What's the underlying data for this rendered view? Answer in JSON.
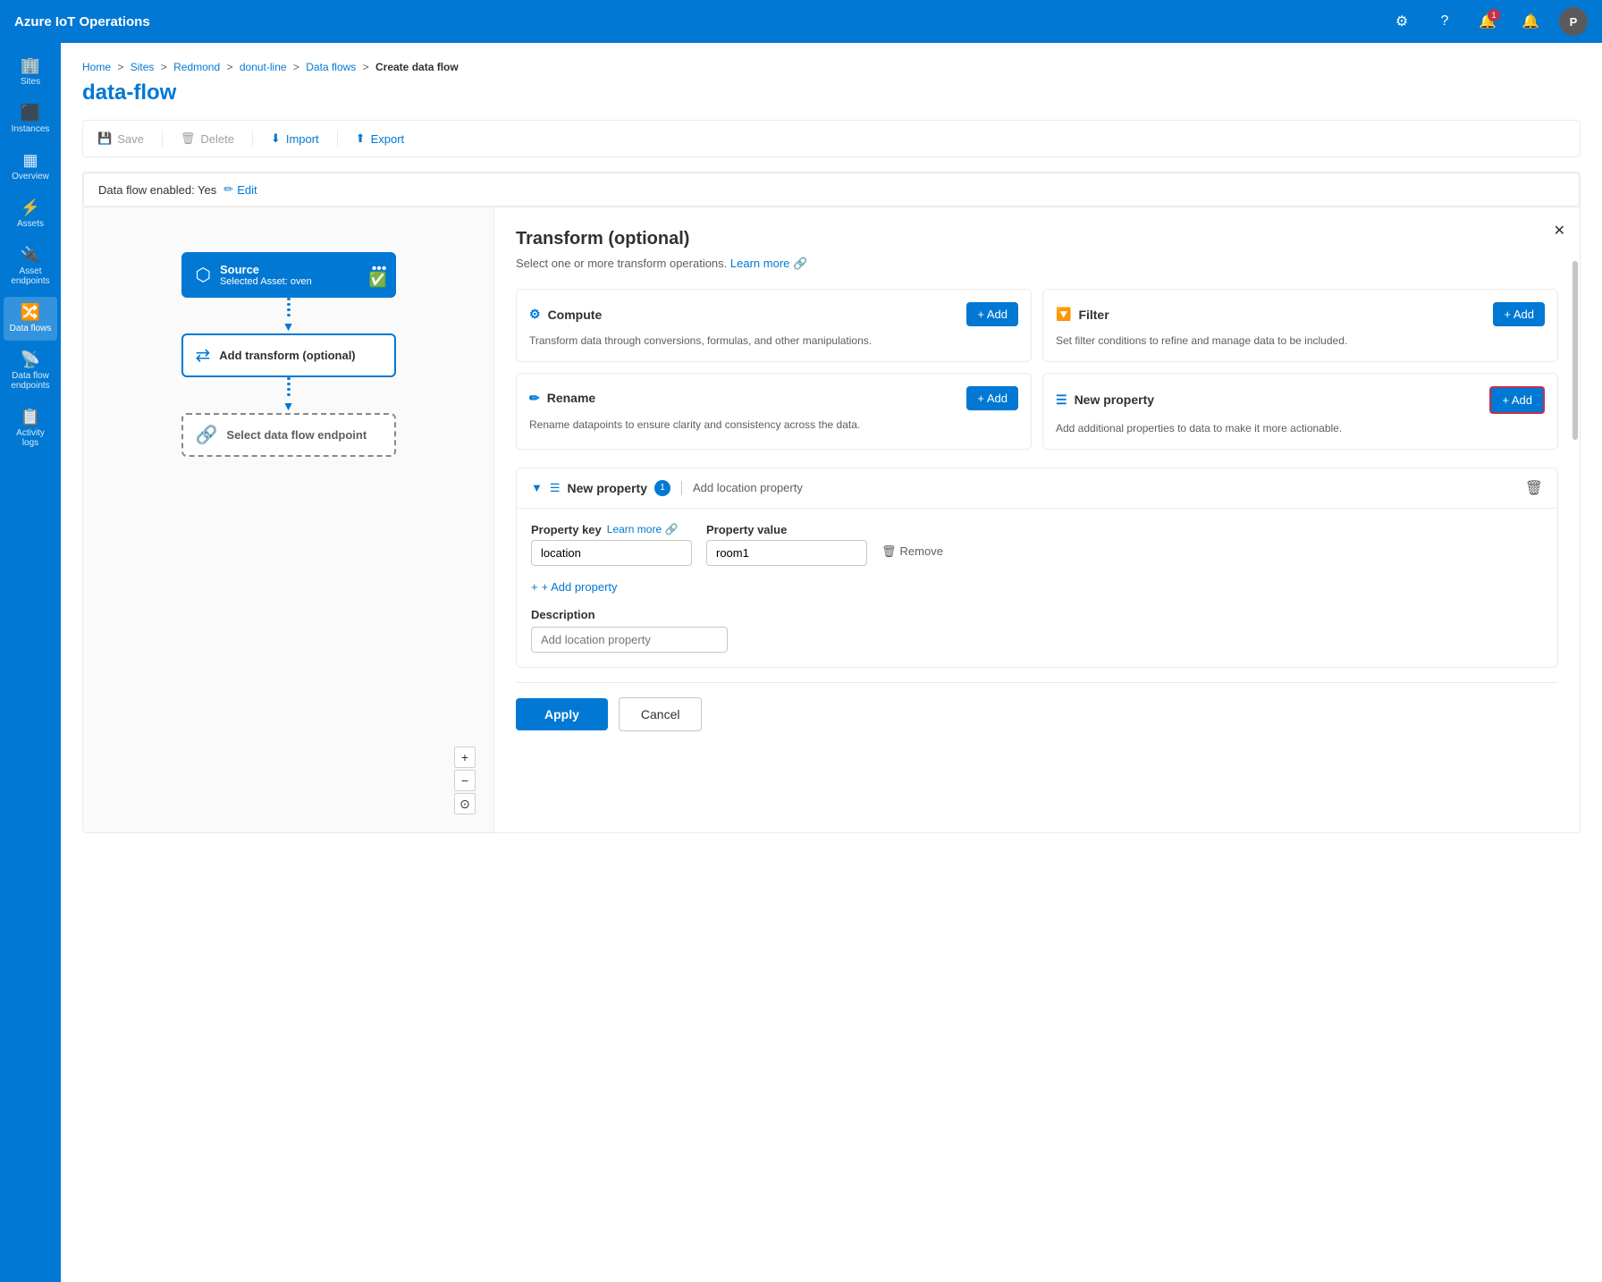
{
  "app": {
    "title": "Azure IoT Operations",
    "avatar_label": "P"
  },
  "sidebar": {
    "items": [
      {
        "id": "sites",
        "label": "Sites",
        "icon": "🏢"
      },
      {
        "id": "instances",
        "label": "Instances",
        "icon": "📦"
      },
      {
        "id": "overview",
        "label": "Overview",
        "icon": "🔲"
      },
      {
        "id": "assets",
        "label": "Assets",
        "icon": "⚡"
      },
      {
        "id": "asset-endpoints",
        "label": "Asset endpoints",
        "icon": "🔌"
      },
      {
        "id": "data-flows",
        "label": "Data flows",
        "icon": "🔀",
        "active": true
      },
      {
        "id": "data-flow-endpoints",
        "label": "Data flow endpoints",
        "icon": "📡"
      },
      {
        "id": "activity-logs",
        "label": "Activity logs",
        "icon": "📋"
      }
    ]
  },
  "breadcrumb": {
    "items": [
      "Home",
      "Sites",
      "Redmond",
      "donut-line",
      "Data flows"
    ],
    "current": "Create data flow"
  },
  "page": {
    "title": "data-flow"
  },
  "toolbar": {
    "save_label": "Save",
    "delete_label": "Delete",
    "import_label": "Import",
    "export_label": "Export"
  },
  "flow_enabled": {
    "label": "Data flow enabled: Yes",
    "edit_label": "Edit"
  },
  "canvas": {
    "source_node": {
      "title": "Source",
      "label": "Selected Asset: oven"
    },
    "transform_node": {
      "title": "Add transform (optional)"
    },
    "endpoint_node": {
      "title": "Select data flow endpoint"
    },
    "zoom_plus": "+",
    "zoom_minus": "−",
    "zoom_reset": "⊙"
  },
  "panel": {
    "title": "Transform (optional)",
    "subtitle": "Select one or more transform operations.",
    "learn_more": "Learn more",
    "ops": [
      {
        "id": "compute",
        "title": "Compute",
        "desc": "Transform data through conversions, formulas, and other manipulations.",
        "add_label": "+ Add"
      },
      {
        "id": "filter",
        "title": "Filter",
        "desc": "Set filter conditions to refine and manage data to be included.",
        "add_label": "+ Add"
      },
      {
        "id": "rename",
        "title": "Rename",
        "desc": "Rename datapoints to ensure clarity and consistency across the data.",
        "add_label": "+ Add"
      },
      {
        "id": "new-property",
        "title": "New property",
        "desc": "Add additional properties to data to make it more actionable.",
        "add_label": "+ Add",
        "highlighted": true
      }
    ],
    "new_property": {
      "title": "New property",
      "badge": "1",
      "description_text": "Add location property",
      "property_key_label": "Property key",
      "property_key_learn_more": "Learn more",
      "property_key_value": "location",
      "property_value_label": "Property value",
      "property_value_value": "room1",
      "remove_label": "Remove",
      "add_property_label": "+ Add property",
      "description_label": "Description",
      "description_placeholder": "Add location property"
    },
    "footer": {
      "apply_label": "Apply",
      "cancel_label": "Cancel"
    }
  }
}
